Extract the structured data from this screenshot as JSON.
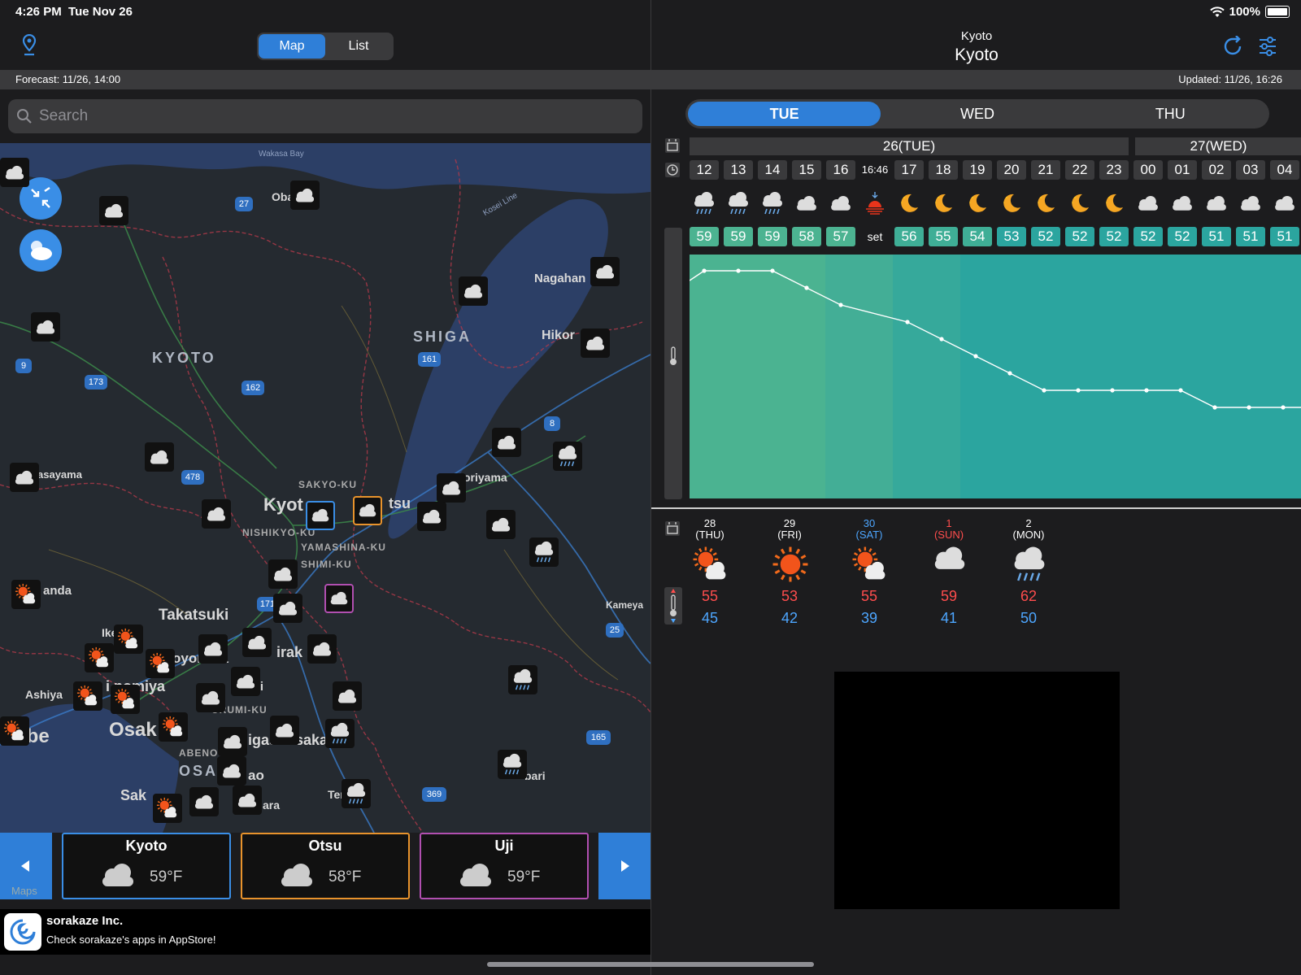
{
  "status": {
    "time": "4:26 PM",
    "date": "Tue Nov 26",
    "battery": "100%"
  },
  "left": {
    "segments": [
      "Map",
      "List"
    ],
    "active_segment": "Map",
    "forecast_label": "Forecast: 11/26, 14:00",
    "search_placeholder": "Search",
    "map_labels": {
      "wakasa_bay": "Wakasa Bay",
      "obama": "Obar",
      "kosei_line": "Kosei Line",
      "nagahama": "Nagahan",
      "shiga": "SHIGA",
      "hikone": "Hikor",
      "kyoto_pref": "KYOTO",
      "sasayama": "asayama",
      "sakyo": "SAKYO-KU",
      "kyoto_city": "Kyot",
      "otsu": "tsu",
      "moriyama": "oriyama",
      "nishikyo": "NISHIKYO-KU",
      "yamashina": "YAMASHINA-KU",
      "fushimi": "SHIMI-KU",
      "kameyama": "Kameya",
      "anda": "anda",
      "takatsuki": "Takatsuki",
      "ike": "Ike",
      "toyonaka": "oyonaka",
      "hirakata": "irak",
      "ashiya": "Ashiya",
      "nishinomiya": "i  nomiya",
      "neyagawa": "guchi",
      "kobe": "obe",
      "osaka": "Osak",
      "toshimizu": "URUMI-KU",
      "higashiosaka": "igasnosaka",
      "abeno": "ABENO-KU",
      "osaka_pref": "OSAKA",
      "yao": "ao",
      "sakai": "Sak",
      "tenri": "Ter",
      "nara": "ara",
      "sabari": "bari",
      "maps_credit": "Maps"
    },
    "road_shields": [
      "27",
      "9",
      "173",
      "162",
      "161",
      "478",
      "8",
      "171",
      "25",
      "165",
      "369"
    ],
    "cards": [
      {
        "name": "Kyoto",
        "temp": "59°F",
        "color": "#3a8ee6"
      },
      {
        "name": "Otsu",
        "temp": "58°F",
        "color": "#e8932c"
      },
      {
        "name": "Uji",
        "temp": "59°F",
        "color": "#b14fb0"
      }
    ],
    "ad": {
      "title": "sorakaze Inc.",
      "subtitle": "Check sorakaze's apps in AppStore!"
    }
  },
  "right": {
    "city_small": "Kyoto",
    "city": "Kyoto",
    "updated_label": "Updated: 11/26, 16:26",
    "day_tabs": [
      "TUE",
      "WED",
      "THU"
    ],
    "active_day": "TUE",
    "day_headers": [
      "26(TUE)",
      "27(WED)"
    ],
    "hours": [
      "12",
      "13",
      "14",
      "15",
      "16",
      "16:46",
      "17",
      "18",
      "19",
      "20",
      "21",
      "22",
      "23",
      "00",
      "01",
      "02",
      "03",
      "04"
    ],
    "hour_icons": [
      "rain-cloud-icon",
      "rain-cloud-icon",
      "rain-cloud-icon",
      "cloud-icon",
      "cloud-icon",
      "sunset-icon",
      "moon-icon",
      "moon-icon",
      "moon-icon",
      "moon-icon",
      "moon-icon",
      "moon-icon",
      "moon-icon",
      "cloud-icon",
      "cloud-icon",
      "cloud-icon",
      "cloud-icon",
      "cloud-icon"
    ],
    "temps": [
      "59",
      "59",
      "59",
      "58",
      "57",
      "set",
      "56",
      "55",
      "54",
      "53",
      "52",
      "52",
      "52",
      "52",
      "52",
      "51",
      "51",
      "51"
    ],
    "chart_data": {
      "type": "line",
      "x": [
        "12",
        "13",
        "14",
        "15",
        "16",
        "17",
        "18",
        "19",
        "20",
        "21",
        "22",
        "23",
        "00",
        "01",
        "02",
        "03",
        "04"
      ],
      "series": [
        {
          "values": [
            59,
            59,
            59,
            58,
            57,
            56,
            55,
            54,
            53,
            52,
            52,
            52,
            52,
            52,
            51,
            51,
            51
          ]
        }
      ]
    },
    "daily": [
      {
        "date": "28",
        "dow": "(THU)",
        "hi": "55",
        "lo": "45",
        "icon": "sun-cloud-icon",
        "color": "#ffffff"
      },
      {
        "date": "29",
        "dow": "(FRI)",
        "hi": "53",
        "lo": "42",
        "icon": "sun-icon",
        "color": "#ffffff"
      },
      {
        "date": "30",
        "dow": "(SAT)",
        "hi": "55",
        "lo": "39",
        "icon": "sun-cloud-icon",
        "color": "#4da6ff"
      },
      {
        "date": "1",
        "dow": "(SUN)",
        "hi": "59",
        "lo": "41",
        "icon": "cloud-icon",
        "color": "#ff4d4d"
      },
      {
        "date": "2",
        "dow": "(MON)",
        "hi": "62",
        "lo": "50",
        "icon": "rain-cloud-icon",
        "color": "#ffffff"
      }
    ]
  }
}
